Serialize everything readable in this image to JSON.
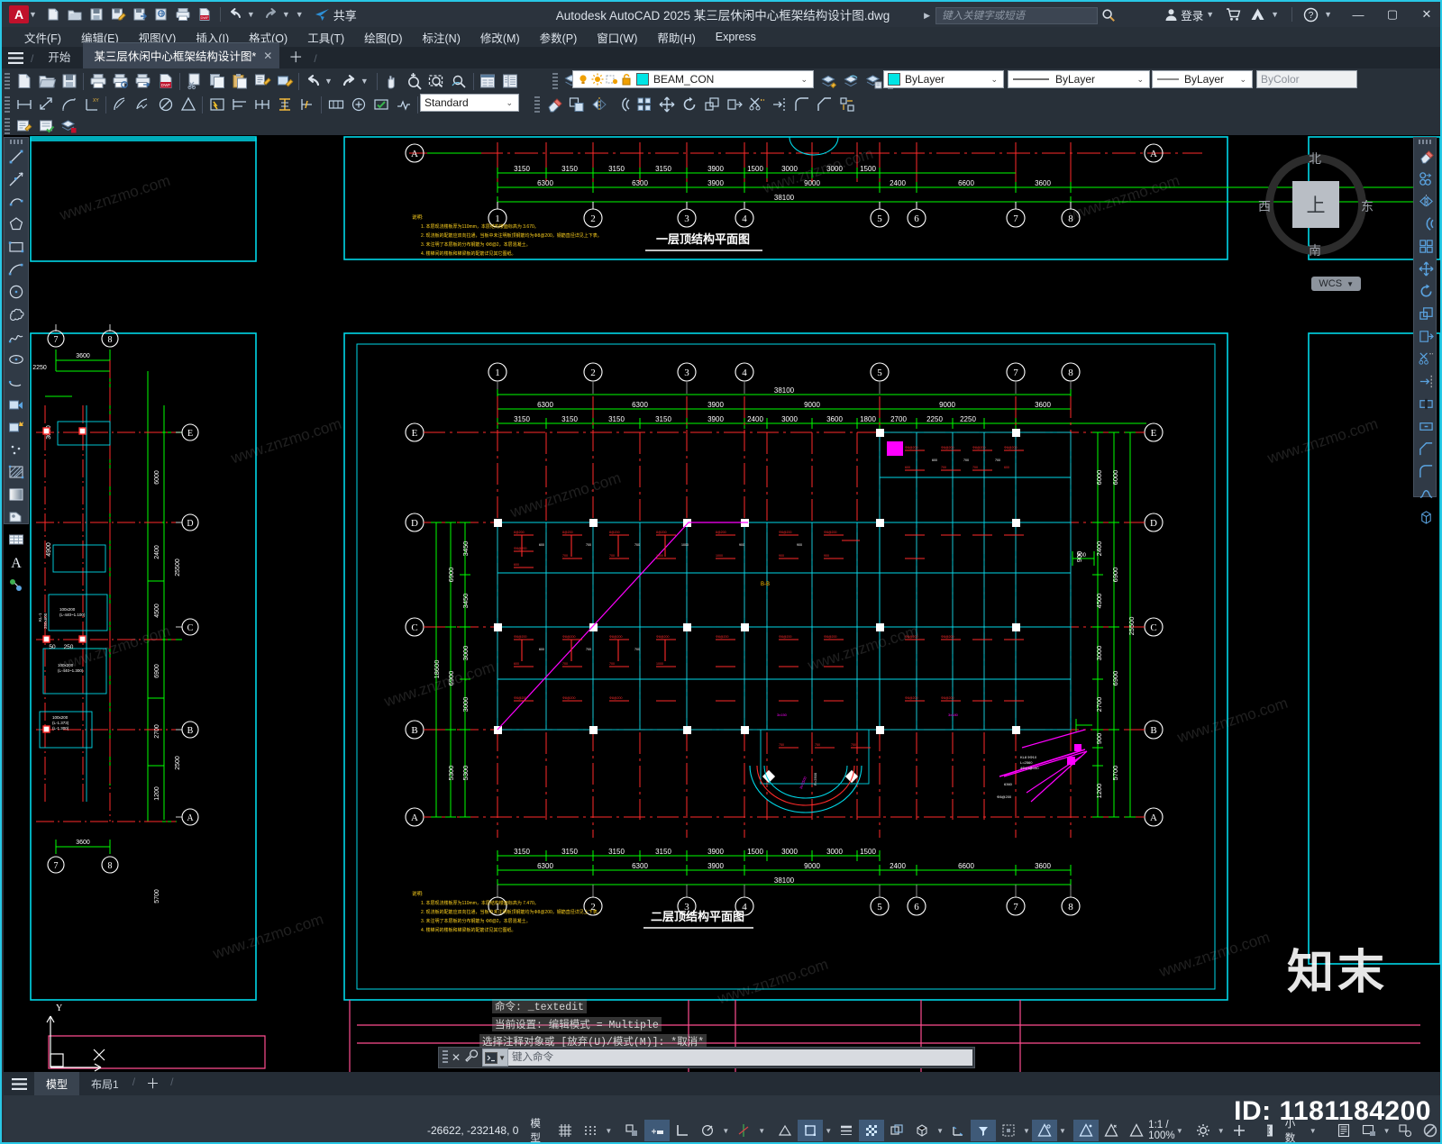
{
  "titlebar": {
    "app_icon": "autocad-a-icon",
    "quick_access": [
      {
        "name": "new-file-icon",
        "label": "新建"
      },
      {
        "name": "open-file-icon",
        "label": "打开"
      },
      {
        "name": "save-icon",
        "label": "保存"
      },
      {
        "name": "save-as-icon",
        "label": "另存为"
      },
      {
        "name": "cloud-save-icon",
        "label": "保存到Web"
      },
      {
        "name": "open-from-web-icon",
        "label": "从Web打开"
      },
      {
        "name": "plot-icon",
        "label": "打印"
      },
      {
        "name": "undo-icon",
        "label": "放弃"
      },
      {
        "name": "redo-icon",
        "label": "重做"
      }
    ],
    "share_label": "共享",
    "title": "Autodesk AutoCAD 2025    某三层休闲中心框架结构设计图.dwg",
    "search_placeholder": "键入关键字或短语",
    "sign_in_label": "登录",
    "window_buttons": {
      "minimize": "—",
      "maximize": "▢",
      "close": "✕"
    }
  },
  "menubar": {
    "items": [
      {
        "label": "文件(F)",
        "name": "menu-file"
      },
      {
        "label": "编辑(E)",
        "name": "menu-edit"
      },
      {
        "label": "视图(V)",
        "name": "menu-view"
      },
      {
        "label": "插入(I)",
        "name": "menu-insert"
      },
      {
        "label": "格式(O)",
        "name": "menu-format"
      },
      {
        "label": "工具(T)",
        "name": "menu-tools"
      },
      {
        "label": "绘图(D)",
        "name": "menu-draw"
      },
      {
        "label": "标注(N)",
        "name": "menu-dimension"
      },
      {
        "label": "修改(M)",
        "name": "menu-modify"
      },
      {
        "label": "参数(P)",
        "name": "menu-parametric"
      },
      {
        "label": "窗口(W)",
        "name": "menu-window"
      },
      {
        "label": "帮助(H)",
        "name": "menu-help"
      },
      {
        "label": "Express",
        "name": "menu-express"
      }
    ]
  },
  "tabstrip": {
    "start_tab": "开始",
    "file_tab": "某三层休闲中心框架结构设计图*",
    "close_glyph": "✕",
    "add_glyph": "＋"
  },
  "toolbars": {
    "layer_name": "BEAM_CON",
    "text_style": "Standard",
    "color": "ByLayer",
    "linetype": "ByLayer",
    "lineweight": "ByLayer",
    "plotstyle": "ByColor"
  },
  "viewcube": {
    "top": "上",
    "north": "北",
    "south": "南",
    "east": "东",
    "west": "西",
    "ucs": "WCS"
  },
  "command_window": {
    "history": [
      "命令: _textedit",
      "当前设置: 编辑模式 = Multiple",
      "选择注释对象或 [放弃(U)/模式(M)]: *取消*"
    ],
    "input_placeholder": "键入命令"
  },
  "layout_tabs": {
    "model": "模型",
    "layout1": "布局1",
    "plus": "＋"
  },
  "statusbar": {
    "coordinates": "-26622, -232148, 0",
    "space": "模型",
    "scale": "1:1 / 100%",
    "units": "小数",
    "id_label": "ID: 1181184200",
    "toggles": [
      {
        "name": "grid-display-toggle",
        "label": "栅格"
      },
      {
        "name": "snap-mode-toggle",
        "label": "捕捉"
      },
      {
        "name": "ortho-mode-toggle",
        "label": "正交"
      },
      {
        "name": "polar-tracking-toggle",
        "label": "极轴"
      },
      {
        "name": "osnap-toggle",
        "label": "对象捕捉"
      },
      {
        "name": "otrack-toggle",
        "label": "对象追踪"
      },
      {
        "name": "lineweight-toggle",
        "label": "线宽"
      },
      {
        "name": "transparency-toggle",
        "label": "透明度"
      },
      {
        "name": "selection-cycling-toggle",
        "label": "选择循环"
      },
      {
        "name": "3d-osnap-toggle",
        "label": "三维对象捕捉"
      },
      {
        "name": "dynamic-ucs-toggle",
        "label": "动态UCS"
      },
      {
        "name": "dynamic-input-toggle",
        "label": "动态输入"
      },
      {
        "name": "annotation-visibility-toggle",
        "label": "注释可见性"
      },
      {
        "name": "autoscale-toggle",
        "label": "自动缩放"
      },
      {
        "name": "workspace-switch",
        "label": "切换工作空间"
      },
      {
        "name": "hardware-accel-toggle",
        "label": "硬件加速"
      },
      {
        "name": "isolate-objects-toggle",
        "label": "隔离对象"
      },
      {
        "name": "clean-screen-toggle",
        "label": "全屏显示"
      },
      {
        "name": "customization-menu",
        "label": "自定义"
      }
    ]
  },
  "drawing": {
    "watermark_small": "www.znzmo.com",
    "watermark_big": "知末",
    "plan_upper": {
      "title": "一层顶结构平面图",
      "notes_head": "说明:",
      "notes": [
        "1. 本层现浇楼板厚为110mm，本层结构楼面标高为 3.670。",
        "2. 现浇板的配筋应双向拉通，当板中未注明的板顶钢筋均为Φ8@200，钢筋直径详见上下表。",
        "3. 未注明了本层板的分布钢筋为 Φ8@2，本层混凝土。",
        "4. 楼梯间的楼板和梯梁板的配筋详见其它图纸。"
      ],
      "grid_columns": [
        "1",
        "2",
        "3",
        "4",
        "5",
        "6",
        "7",
        "8"
      ],
      "grid_rows": [
        "A",
        "B",
        "C",
        "D",
        "E"
      ],
      "dims_bottom_inner": [
        "3150",
        "3150",
        "3150",
        "3150",
        "3900",
        "1500",
        "3000",
        "3000",
        "1500"
      ],
      "dims_bottom_mid": [
        "6300",
        "6300",
        "3900",
        "9000",
        "2400",
        "6600",
        "3600"
      ],
      "dims_bottom_total": "38100"
    },
    "plan_lower": {
      "title": "二层顶结构平面图",
      "notes_head": "说明:",
      "notes": [
        "1. 本层现浇楼板厚为110mm，本层结构楼面标高为 7.470。",
        "2. 现浇板的配筋应双向拉通，当板中未注明的板顶钢筋均为Φ8@200，钢筋直径详见上下表。",
        "3. 未注明了本层板的分布钢筋为 Φ8@2，本层混凝土。",
        "4. 楼梯间的楼板和梯梁板的配筋详见其它图纸。"
      ],
      "grid_columns": [
        "1",
        "2",
        "3",
        "4",
        "5",
        "6",
        "7",
        "8"
      ],
      "grid_rows": [
        "A",
        "B",
        "C",
        "D",
        "E"
      ],
      "dims_top_total": "38100",
      "dims_top_mid": [
        "6300",
        "6300",
        "3900",
        "9000",
        "9000",
        "3600"
      ],
      "dims_top_inner": [
        "3150",
        "3150",
        "3150",
        "3150",
        "3900",
        "2400",
        "3000",
        "3600",
        "1800",
        "2700",
        "2250",
        "2250"
      ],
      "dims_bottom_inner": [
        "3150",
        "3150",
        "3150",
        "3150",
        "3900",
        "1500",
        "3000",
        "3000",
        "1500"
      ],
      "dims_bottom_mid": [
        "6300",
        "6300",
        "3900",
        "9000",
        "2400",
        "6600",
        "3600"
      ],
      "dims_bottom_total": "38100",
      "dims_left": [
        "3450",
        "3450",
        "3000",
        "3000",
        "5300"
      ],
      "dims_left_total": "18600",
      "dims_left_mid": [
        "6900",
        "6900",
        "5300"
      ],
      "dims_right": [
        "6000",
        "2400",
        "4500",
        "3000",
        "2700",
        "900",
        "1200",
        "5700"
      ],
      "dims_right_mid": [
        "6000",
        "6900",
        "6900",
        "5700"
      ],
      "dims_right_total": "25500",
      "misc_dims": [
        "900",
        "800",
        "300",
        "50",
        "250",
        "2250",
        "3600",
        "4500",
        "2400"
      ]
    },
    "detail_left": {
      "grid_columns": [
        "7",
        "8"
      ],
      "grid_rows": [
        "A",
        "B",
        "C",
        "D",
        "E"
      ],
      "dims": [
        "3600",
        "2250",
        "2500",
        "6000",
        "2400",
        "4500",
        "6900",
        "2700",
        "1200",
        "5700",
        "50",
        "250",
        "3600"
      ]
    },
    "colors": {
      "grid_green": "#00ff00",
      "axis_red": "#ff0000",
      "cyan": "#00ffff",
      "magenta": "#ff00ff",
      "yellow": "#ffff00",
      "white": "#ffffff"
    }
  }
}
